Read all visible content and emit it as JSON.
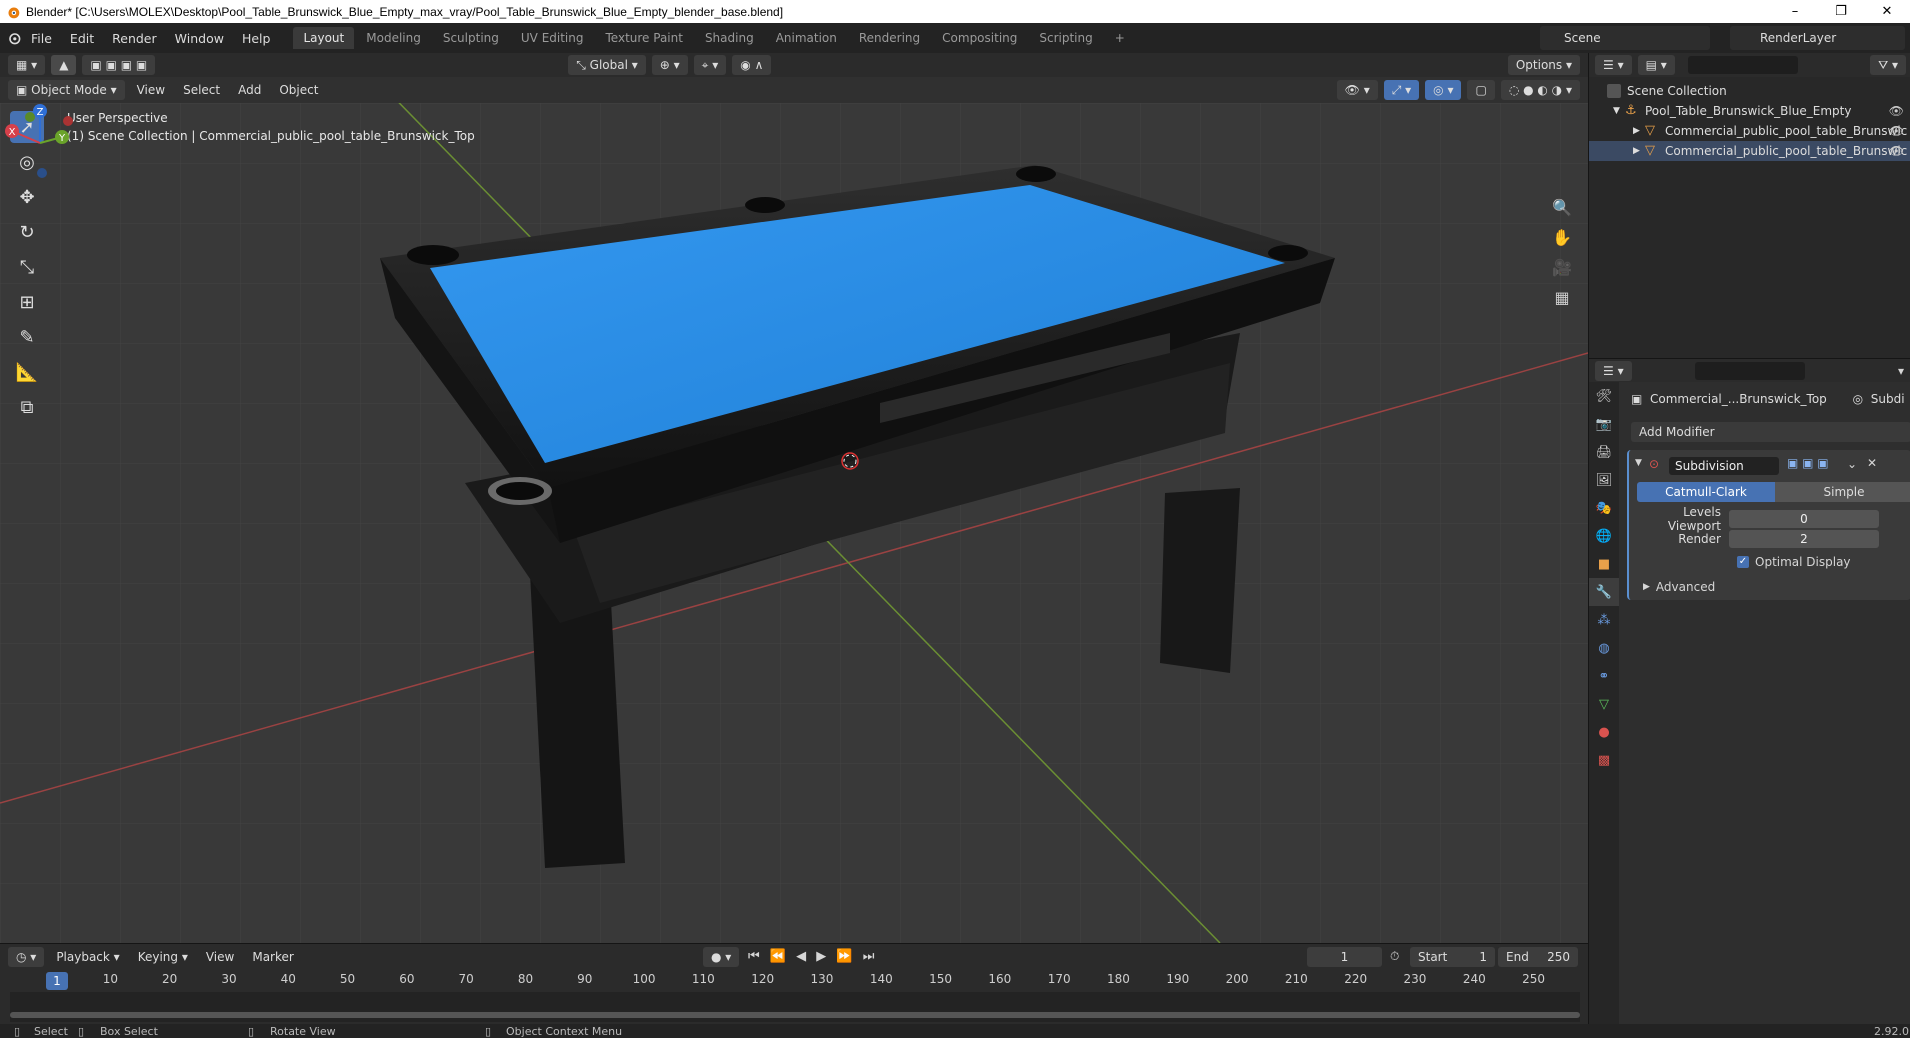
{
  "window": {
    "title": "Blender* [C:\\Users\\MOLEX\\Desktop\\Pool_Table_Brunswick_Blue_Empty_max_vray/Pool_Table_Brunswick_Blue_Empty_blender_base.blend]",
    "controls": [
      "–",
      "❐",
      "✕"
    ]
  },
  "menu": [
    "File",
    "Edit",
    "Render",
    "Window",
    "Help"
  ],
  "workspaces": {
    "active": "Layout",
    "tabs": [
      "Layout",
      "Modeling",
      "Sculpting",
      "UV Editing",
      "Texture Paint",
      "Shading",
      "Animation",
      "Rendering",
      "Compositing",
      "Scripting"
    ],
    "add": "+"
  },
  "scene": {
    "name": "Scene",
    "view_layer": "RenderLayer"
  },
  "viewport_header": {
    "transform_orientation": "Global",
    "options": "Options",
    "mode": "Object Mode",
    "menus": [
      "View",
      "Select",
      "Add",
      "Object"
    ]
  },
  "viewport": {
    "perspective": "User Perspective",
    "collection_info": "(1) Scene Collection | Commercial_public_pool_table_Brunswick_Top",
    "gizmo_axes": [
      "X",
      "Y",
      "Z"
    ],
    "tools": [
      "select-box",
      "cursor",
      "move",
      "rotate",
      "scale",
      "transform",
      "annotate",
      "measure",
      "add-cube"
    ],
    "colors": {
      "cloth": "#2a8ee8",
      "background": "#393939",
      "x_axis": "#b94a4a",
      "y_axis": "#7aa83a"
    }
  },
  "outliner": {
    "root": "Scene Collection",
    "items": [
      {
        "name": "Pool_Table_Brunswick_Blue_Empty",
        "level": 0
      },
      {
        "name": "Commercial_public_pool_table_Brunswic",
        "level": 1
      },
      {
        "name": "Commercial_public_pool_table_Brunswic",
        "level": 1
      }
    ]
  },
  "properties": {
    "object_name": "Commercial_...Brunswick_Top",
    "modifier_tab": "Subdi",
    "add_modifier": "Add Modifier",
    "modifier": {
      "name": "Subdivision",
      "type_options": [
        "Catmull-Clark",
        "Simple"
      ],
      "type_selected": "Catmull-Clark",
      "levels_viewport_label": "Levels Viewport",
      "levels_viewport": "0",
      "render_label": "Render",
      "render": "2",
      "optimal_display_label": "Optimal Display",
      "optimal_display": true,
      "advanced_label": "Advanced"
    }
  },
  "timeline": {
    "menus": [
      "Playback",
      "Keying",
      "View",
      "Marker"
    ],
    "current_frame": "1",
    "start_label": "Start",
    "start": "1",
    "end_label": "End",
    "end": "250",
    "ticks": [
      1,
      10,
      20,
      30,
      40,
      50,
      60,
      70,
      80,
      90,
      100,
      110,
      120,
      130,
      140,
      150,
      160,
      170,
      180,
      190,
      200,
      210,
      220,
      230,
      240,
      250
    ]
  },
  "statusbar": {
    "select": "Select",
    "box_select": "Box Select",
    "rotate_view": "Rotate View",
    "context_menu": "Object Context Menu",
    "version": "2.92.0"
  }
}
